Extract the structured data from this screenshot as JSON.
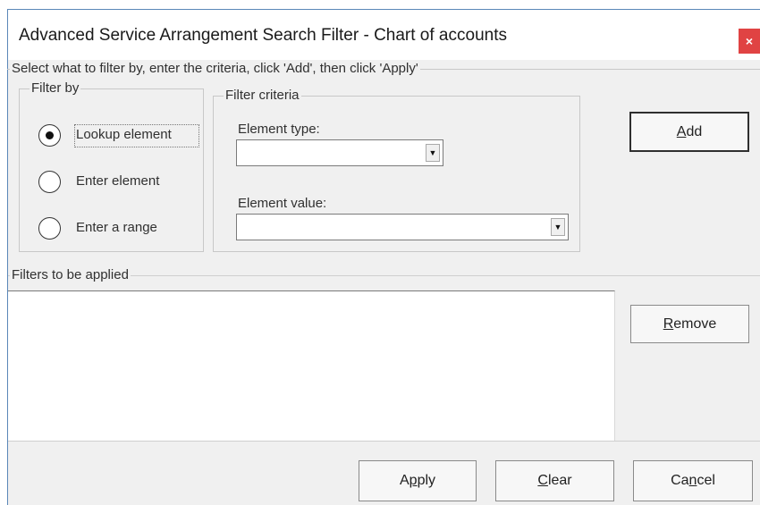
{
  "window": {
    "title": "Advanced Service Arrangement Search Filter - Chart of accounts",
    "close_glyph": "×"
  },
  "instructions": "Select what to filter by, enter the criteria, click 'Add', then click 'Apply'",
  "filter_by": {
    "legend": "Filter by",
    "options": [
      {
        "label": "Lookup element",
        "selected": true
      },
      {
        "label": "Enter element",
        "selected": false
      },
      {
        "label": "Enter a range",
        "selected": false
      }
    ]
  },
  "filter_criteria": {
    "legend": "Filter criteria",
    "element_type_label": "Element type:",
    "element_type_value": "",
    "element_value_label": "Element value:",
    "element_value_value": ""
  },
  "buttons": {
    "add": {
      "mnemonic": "A",
      "rest": "dd"
    },
    "remove": {
      "mnemonic": "R",
      "rest": "emove"
    },
    "apply": {
      "pre": "A",
      "mnemonic": "p",
      "rest": "ply"
    },
    "clear": {
      "mnemonic": "C",
      "rest": "lear"
    },
    "cancel": {
      "pre": "Ca",
      "mnemonic": "n",
      "rest": "cel"
    }
  },
  "filters_applied": {
    "legend": "Filters to be applied",
    "items": []
  },
  "icons": {
    "close": "close-icon",
    "dropdown": "chevron-down-icon"
  },
  "colors": {
    "close_bg": "#e04343",
    "window_border": "#5a87b8",
    "dialog_bg": "#f0f0f0"
  }
}
